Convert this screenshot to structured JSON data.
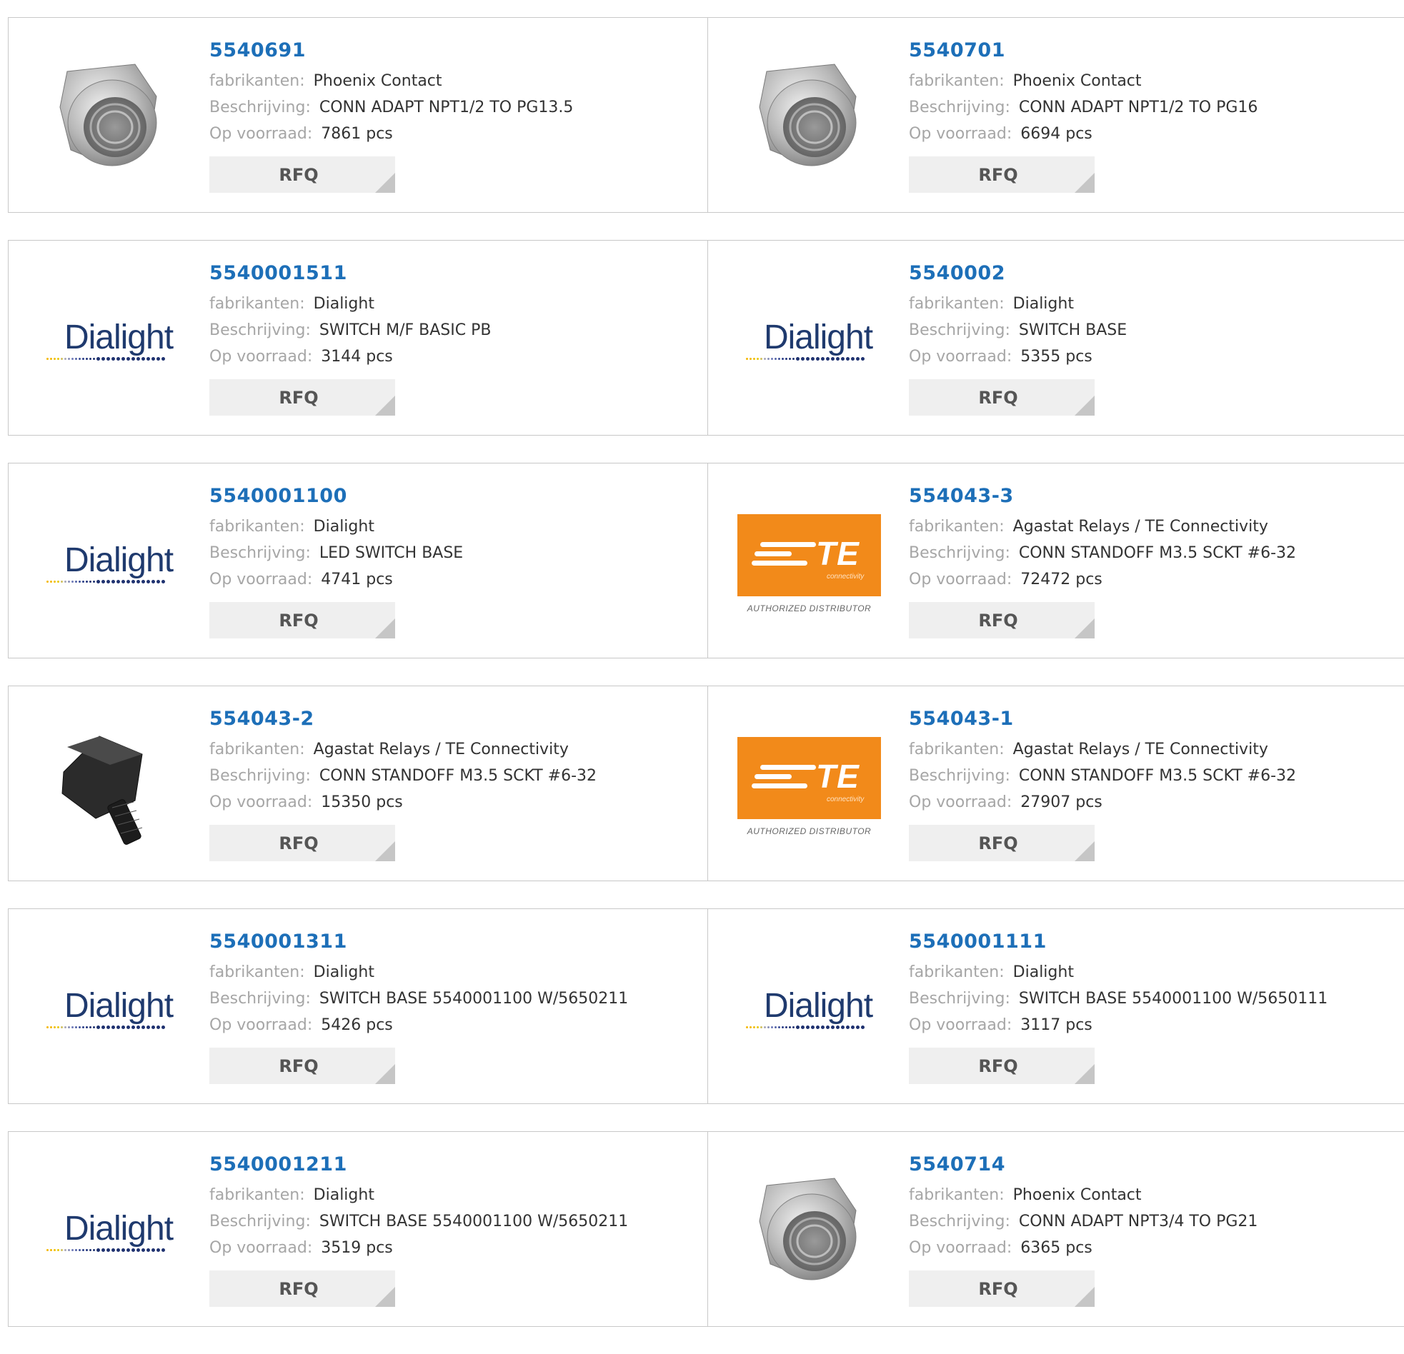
{
  "labels": {
    "manufacturer": "fabrikanten:",
    "description": "Beschrijving:",
    "stock": "Op voorraad:",
    "rfq": "RFQ"
  },
  "brand_logos": {
    "dialight": "Dialight",
    "te_letters": "TE",
    "te_sub": "connectivity",
    "te_authorized": "AUTHORIZED DISTRIBUTOR"
  },
  "colors": {
    "part_number": "#1d6fb8",
    "label": "#a6a6a6",
    "value": "#333333",
    "rfq_bg": "#efefef",
    "te_orange": "#f28a1a",
    "dialight_blue": "#1f3a6e"
  },
  "products": [
    {
      "part": "5540691",
      "manufacturer": "Phoenix Contact",
      "description": "CONN ADAPT NPT1/2 TO PG13.5",
      "stock": "7861 pcs",
      "image": "adapter-fitting-icon"
    },
    {
      "part": "5540701",
      "manufacturer": "Phoenix Contact",
      "description": "CONN ADAPT NPT1/2 TO PG16",
      "stock": "6694 pcs",
      "image": "adapter-fitting-icon"
    },
    {
      "part": "5540001511",
      "manufacturer": "Dialight",
      "description": "SWITCH M/F BASIC PB",
      "stock": "3144 pcs",
      "image": "dialight-logo"
    },
    {
      "part": "5540002",
      "manufacturer": "Dialight",
      "description": "SWITCH BASE",
      "stock": "5355 pcs",
      "image": "dialight-logo"
    },
    {
      "part": "5540001100",
      "manufacturer": "Dialight",
      "description": "LED SWITCH BASE",
      "stock": "4741 pcs",
      "image": "dialight-logo"
    },
    {
      "part": "554043-3",
      "manufacturer": "Agastat Relays / TE Connectivity",
      "description": "CONN STANDOFF M3.5 SCKT #6-32",
      "stock": "72472 pcs",
      "image": "te-logo"
    },
    {
      "part": "554043-2",
      "manufacturer": "Agastat Relays / TE Connectivity",
      "description": "CONN STANDOFF M3.5 SCKT #6-32",
      "stock": "15350 pcs",
      "image": "standoff-screw-icon"
    },
    {
      "part": "554043-1",
      "manufacturer": "Agastat Relays / TE Connectivity",
      "description": "CONN STANDOFF M3.5 SCKT #6-32",
      "stock": "27907 pcs",
      "image": "te-logo"
    },
    {
      "part": "5540001311",
      "manufacturer": "Dialight",
      "description": "SWITCH BASE 5540001100 W/5650211",
      "stock": "5426 pcs",
      "image": "dialight-logo"
    },
    {
      "part": "5540001111",
      "manufacturer": "Dialight",
      "description": "SWITCH BASE 5540001100 W/5650111",
      "stock": "3117 pcs",
      "image": "dialight-logo"
    },
    {
      "part": "5540001211",
      "manufacturer": "Dialight",
      "description": "SWITCH BASE 5540001100 W/5650211",
      "stock": "3519 pcs",
      "image": "dialight-logo"
    },
    {
      "part": "5540714",
      "manufacturer": "Phoenix Contact",
      "description": "CONN ADAPT NPT3/4 TO PG21",
      "stock": "6365 pcs",
      "image": "adapter-fitting-icon"
    }
  ]
}
